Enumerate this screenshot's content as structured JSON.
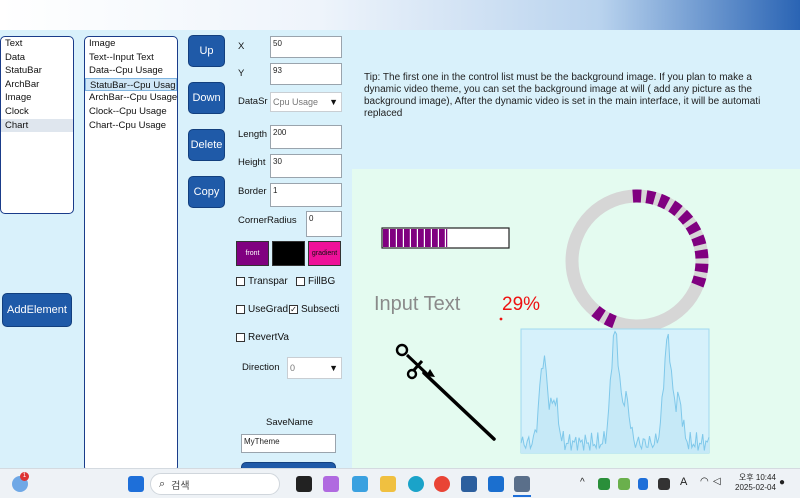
{
  "element_types": [
    "Text",
    "Data",
    "StatuBar",
    "ArchBar",
    "Image",
    "Clock",
    "Chart"
  ],
  "control_list": [
    "Image",
    "Text--Input Text",
    "Data--Cpu Usage",
    "StatuBar--Cpu Usage",
    "ArchBar--Cpu Usage",
    "Clock--Cpu Usage",
    "Chart--Cpu Usage"
  ],
  "buttons": {
    "up": "Up",
    "down": "Down",
    "delete": "Delete",
    "copy": "Copy",
    "add_element": "AddElement"
  },
  "props": {
    "x_label": "X",
    "x_value": "50",
    "y_label": "Y",
    "y_value": "93",
    "datasrc_label": "DataSr",
    "datasrc_value": "Cpu Usage",
    "length_label": "Length",
    "length_value": "200",
    "height_label": "Height",
    "height_value": "30",
    "border_label": "Border",
    "border_value": "1",
    "radius_label": "CornerRadius",
    "radius_value": "0",
    "front_label": "front",
    "gradient_label": "gradient",
    "front_color": "#800080",
    "back_color": "#000000",
    "gradient_color": "#ee1199",
    "transparent_label": "Transpar",
    "fillbg_label": "FillBG",
    "usegrad_label": "UseGrad",
    "subsection_label": "Subsecti",
    "revert_label": "RevertVa",
    "direction_label": "Direction",
    "direction_value": "0",
    "savename_label": "SaveName",
    "savename_value": "MyTheme"
  },
  "tip": [
    "Tip: The first one in the control list must be the background image. If you plan to make a",
    "dynamic video theme, you can set the background image at will ( add any picture as the",
    "background image), After the dynamic video is set in the main interface, it will be automati",
    "replaced"
  ],
  "preview": {
    "input_text": "Input Text",
    "percent": "29%",
    "accent": "#800080",
    "progress": 0.29,
    "ring_segments": 10,
    "ring_total": 30
  },
  "taskbar": {
    "search_placeholder": "검색",
    "ampm": "오후",
    "time": "10:44",
    "date": "2025-02-04"
  }
}
